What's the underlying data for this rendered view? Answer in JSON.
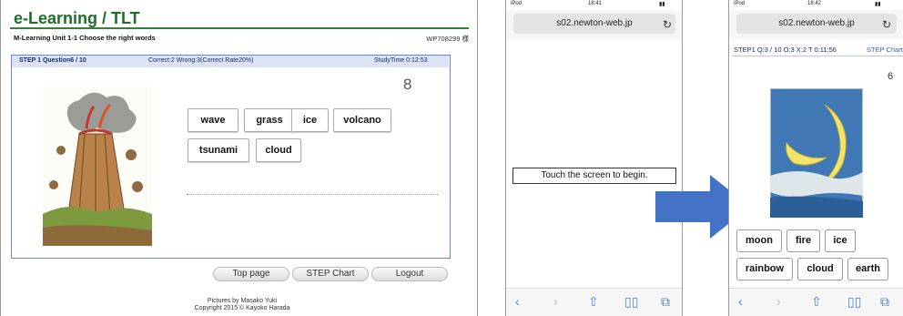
{
  "desktop": {
    "app_title": "e-Learning / TLT",
    "subtitle": "M-Learning  Unit 1-1 Choose the right words",
    "user_id": "WP708299 様",
    "status": {
      "step": "STEP 1  Question6 / 10",
      "score": "Correct:2  Wrong:3(Correct Rate20%)",
      "time": "StudyTime  0:12:53"
    },
    "question_number": "8",
    "words": [
      "wave",
      "grass",
      "ice",
      "volcano",
      "tsunami",
      "cloud"
    ],
    "nav": {
      "top_page": "Top page",
      "step_chart": "STEP Chart",
      "logout": "Logout"
    },
    "footer": {
      "line1": "Pictures by Masako Yuki",
      "line2": "Copyright 2015 © Kayoko Harada"
    }
  },
  "phone1": {
    "carrier": "iPod",
    "time": "18:41",
    "url": "s02.newton-web.jp",
    "touch_prompt": "Touch the screen to begin."
  },
  "phone2": {
    "carrier": "iPod",
    "time": "18:42",
    "url": "s02.newton-web.jp",
    "step": "STEP1  Q:3 / 10  O:3  X:2  T 0:11:56",
    "step_chart_link": "STEP Chart",
    "question_number": "6",
    "words": [
      "moon",
      "fire",
      "ice",
      "rainbow",
      "cloud",
      "earth"
    ]
  },
  "icons": {
    "reload": "reload-icon",
    "back": "back-icon",
    "forward": "forward-icon",
    "share": "share-icon",
    "bookmarks": "bookmarks-icon",
    "tabs": "tabs-icon",
    "arrow": "right-arrow"
  },
  "colors": {
    "title_green": "#1f6f2a",
    "frame_blue": "#6a88c7",
    "arrow_blue": "#4472c4",
    "ios_blue": "#4a7fd8"
  }
}
